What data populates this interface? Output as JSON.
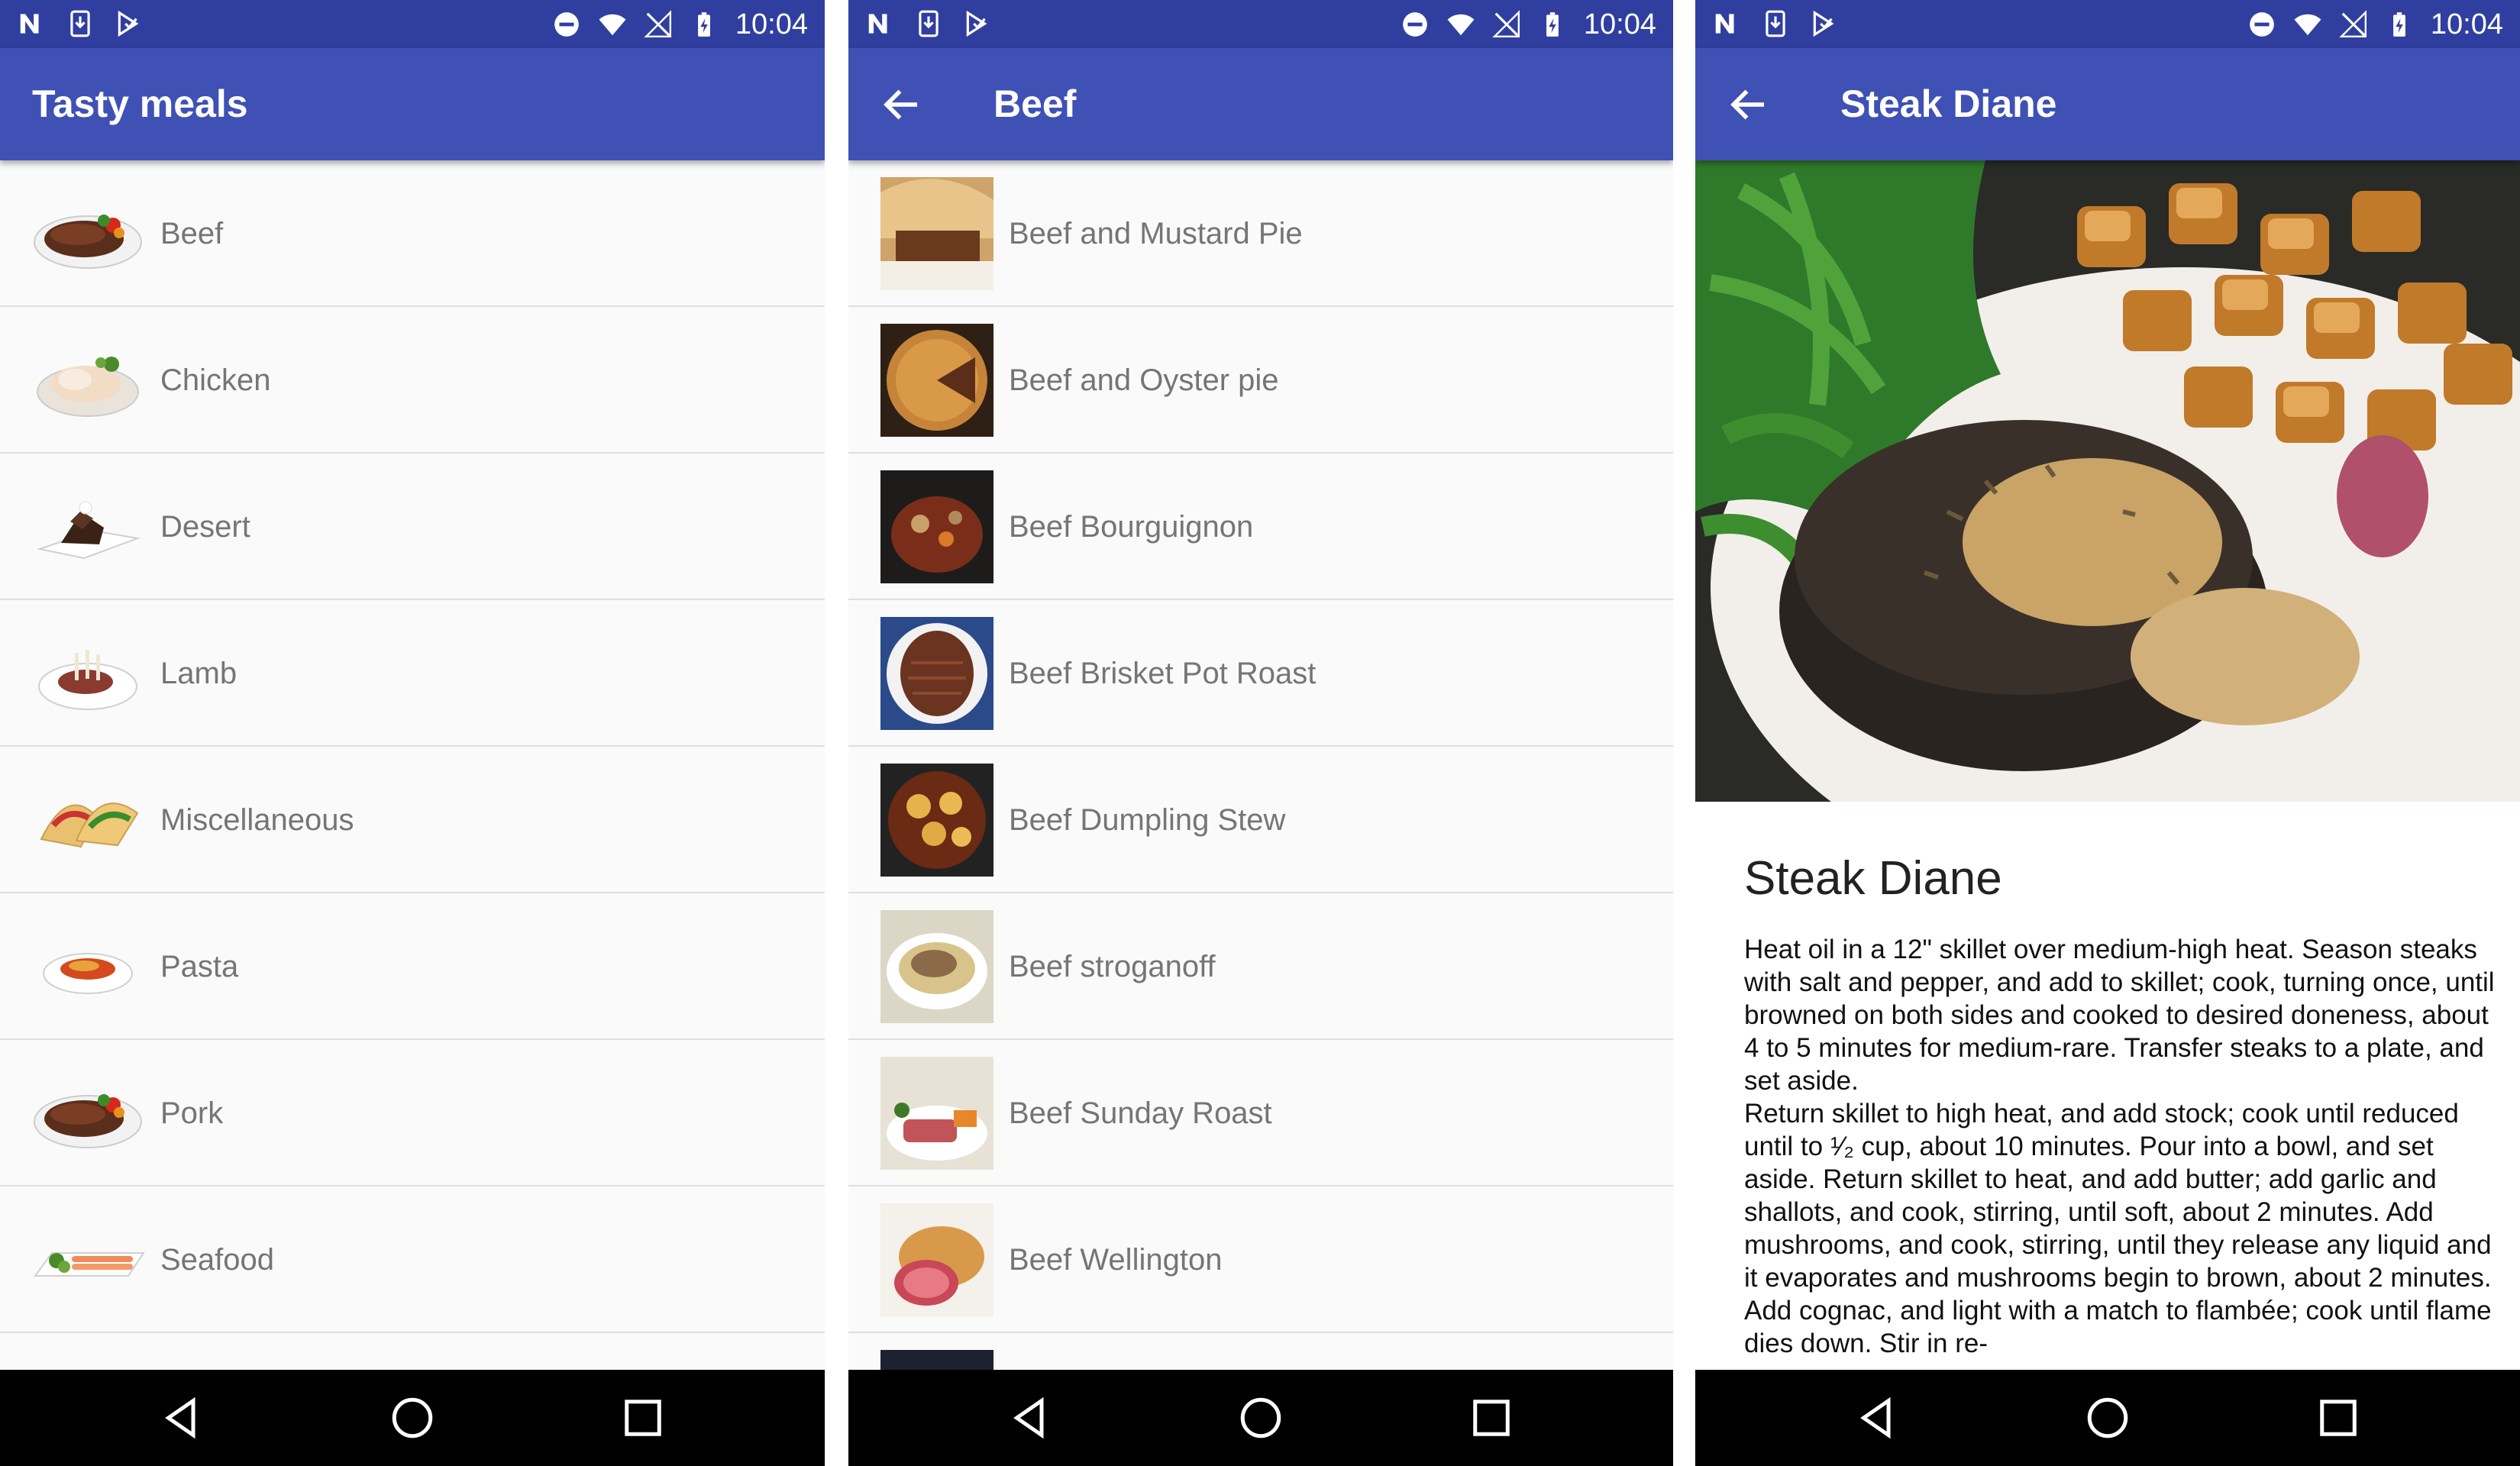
{
  "status_bar": {
    "time": "10:04"
  },
  "screens": [
    {
      "title": "Tasty meals",
      "items": [
        {
          "label": "Beef"
        },
        {
          "label": "Chicken"
        },
        {
          "label": "Desert"
        },
        {
          "label": "Lamb"
        },
        {
          "label": "Miscellaneous"
        },
        {
          "label": "Pasta"
        },
        {
          "label": "Pork"
        },
        {
          "label": "Seafood"
        }
      ]
    },
    {
      "title": "Beef",
      "items": [
        {
          "label": "Beef and Mustard Pie"
        },
        {
          "label": "Beef and Oyster pie"
        },
        {
          "label": "Beef Bourguignon"
        },
        {
          "label": "Beef Brisket Pot Roast"
        },
        {
          "label": "Beef Dumpling Stew"
        },
        {
          "label": "Beef stroganoff"
        },
        {
          "label": "Beef Sunday Roast"
        },
        {
          "label": "Beef Wellington"
        }
      ]
    },
    {
      "title": "Steak Diane",
      "heading": "Steak Diane",
      "instructions": "Heat oil in a 12\" skillet over medium-high heat. Season steaks with salt and pepper, and add to skillet; cook, turning once, until browned on both sides and cooked to desired doneness, about 4 to 5 minutes for medium-rare. Transfer steaks to a plate, and set aside.\nReturn skillet to high heat, and add stock; cook until reduced until to ¹⁄₂ cup, about 10 minutes. Pour into a bowl, and set aside. Return skillet to heat, and add butter; add garlic and shallots, and cook, stirring, until soft, about 2 minutes. Add mushrooms, and cook, stirring, until they release any liquid and it evaporates and mushrooms begin to brown, about 2 minutes. Add cognac, and light with a match to flambée; cook until flame dies down. Stir in re-"
    }
  ],
  "colors": {
    "primary": "#3f51b5",
    "primary_dark": "#303f9f",
    "list_text": "#757575",
    "divider": "#dedede"
  },
  "icons": {
    "back": "arrow-left-icon",
    "nav_back": "triangle-back-icon",
    "nav_home": "circle-home-icon",
    "nav_recents": "square-recents-icon"
  }
}
